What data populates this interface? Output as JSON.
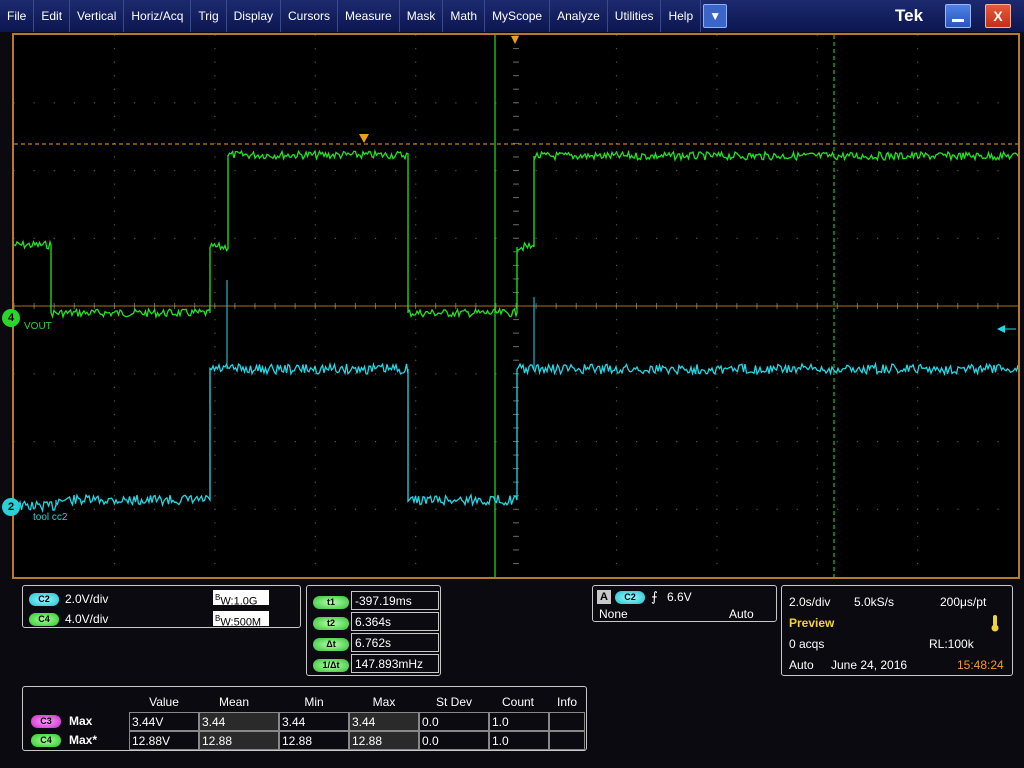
{
  "menu": [
    "File",
    "Edit",
    "Vertical",
    "Horiz/Acq",
    "Trig",
    "Display",
    "Cursors",
    "Measure",
    "Mask",
    "Math",
    "MyScope",
    "Analyze",
    "Utilities",
    "Help"
  ],
  "menu_dropdown_glyph": "▼",
  "brand": {
    "logo": "Tek"
  },
  "window": {
    "minimize_glyph": "",
    "close_glyph": "X"
  },
  "markers": {
    "ch4_number": "4",
    "ch4_label": "VOUT",
    "ch2_number": "2",
    "ch2_label": "tool cc2"
  },
  "colors": {
    "ch_green": "#22e322",
    "ch_cyan": "#22d8e6",
    "trigger_orange": "#e8a020",
    "graticule": "#555555"
  },
  "channels": [
    {
      "badge": "C2",
      "scale": "2.0V/div",
      "bw": "W:1.0G",
      "bw_prefix": "B"
    },
    {
      "badge": "C4",
      "scale": "4.0V/div",
      "bw": "W:500M",
      "bw_prefix": "B"
    }
  ],
  "cursors": [
    {
      "label": "t1",
      "value": "-397.19ms"
    },
    {
      "label": "t2",
      "value": "6.364s"
    },
    {
      "label": "Δt",
      "value": "6.762s"
    },
    {
      "label": "1/Δt",
      "value": "147.893mHz"
    }
  ],
  "trigger": {
    "source_letter": "A",
    "channel": "C2",
    "slope_glyph": "⨍",
    "level": "6.6V",
    "coupling": "None",
    "mode": "Auto"
  },
  "horizontal": {
    "scale": "2.0s/div",
    "sample_rate": "5.0kS/s",
    "resolution": "200μs/pt",
    "state": "Preview",
    "acqs": "0 acqs",
    "record_length": "RL:100k",
    "trigger_mode": "Auto",
    "date": "June 24, 2016",
    "time": "15:48:24"
  },
  "measurements": {
    "headers": [
      "Value",
      "Mean",
      "Min",
      "Max",
      "St Dev",
      "Count",
      "Info"
    ],
    "rows": [
      {
        "badge": "C3",
        "name": "Max",
        "cells": [
          "3.44V",
          "3.44",
          "3.44",
          "3.44",
          "0.0",
          "1.0",
          ""
        ]
      },
      {
        "badge": "C4",
        "name": "Max*",
        "cells": [
          "12.88V",
          "12.88",
          "12.88",
          "12.88",
          "0.0",
          "1.0",
          ""
        ]
      }
    ]
  }
}
